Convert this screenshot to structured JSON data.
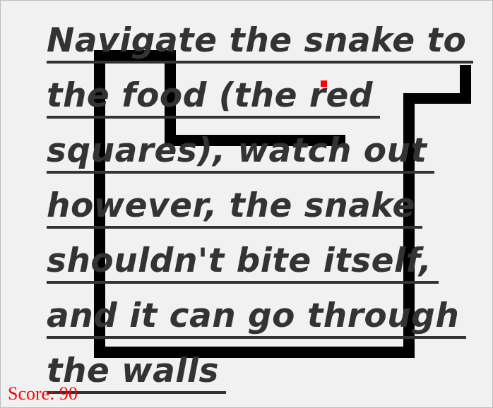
{
  "instructions": {
    "lines": [
      "Navigate the snake to",
      "the food (the red",
      "squares), watch out",
      "however, the snake",
      "shouldn't bite itself,",
      "and it can go through",
      "the walls"
    ]
  },
  "score_label": "Score: 90",
  "colors": {
    "background": "#f1f1f1",
    "snake": "#000000",
    "food": "#ff0000",
    "text": "#333333",
    "score": "#ff0000"
  }
}
